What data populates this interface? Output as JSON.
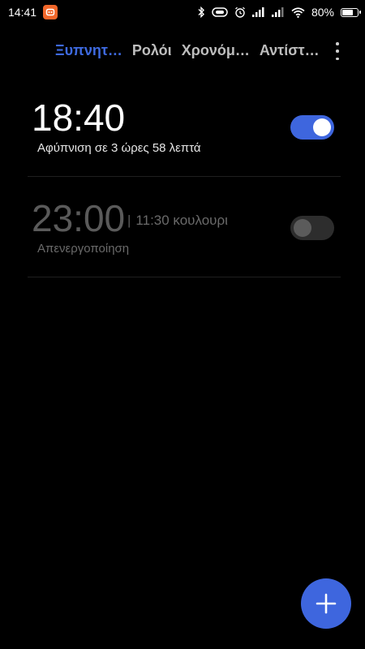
{
  "status_bar": {
    "time": "14:41",
    "battery_text": "80%",
    "battery_level": 0.8,
    "icons": [
      "notification-app-icon",
      "bluetooth-icon",
      "vibrate-icon",
      "alarm-clock-icon",
      "signal-icon",
      "signal-icon",
      "wifi-icon",
      "battery-icon"
    ]
  },
  "tabs": [
    {
      "label": "Ξυπνητ…",
      "active": true
    },
    {
      "label": "Ρολόι",
      "active": false
    },
    {
      "label": "Χρονόμ…",
      "active": false
    },
    {
      "label": "Αντίστ…",
      "active": false
    }
  ],
  "alarms": [
    {
      "time": "18:40",
      "label": "",
      "status": "Αφύπνιση σε 3 ώρες 58 λεπτά",
      "enabled": true
    },
    {
      "time": "23:00",
      "label": "11:30 κουλουρι",
      "separator": "|",
      "status": "Απενεργοποίηση",
      "enabled": false
    }
  ],
  "colors": {
    "accent": "#3e66de",
    "background": "#000000",
    "notification_icon": "#f2672a"
  },
  "fab": {
    "icon": "plus-icon"
  }
}
